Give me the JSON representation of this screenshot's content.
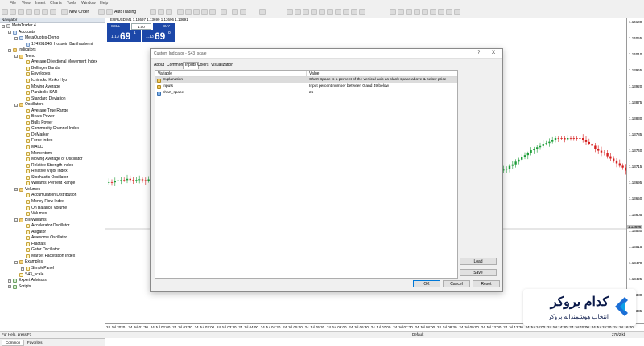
{
  "menu": [
    "File",
    "View",
    "Insert",
    "Charts",
    "Tools",
    "Window",
    "Help"
  ],
  "toolbar": {
    "new_order": "New Order",
    "autotrading": "AutoTrading"
  },
  "chart": {
    "symbol_bar": "EURUSD,M1  1.13697  1.13699  1.13696  1.13691",
    "sell_label": "SELL",
    "buy_label": "BUY",
    "lot": "1.00",
    "sell_price_small": "1.13",
    "sell_price_big": "69",
    "sell_price_sup": "1",
    "buy_price_small": "1.13",
    "buy_price_big": "69",
    "buy_price_sup": "8",
    "price_labels": [
      "1.14100",
      "1.14055",
      "1.14010",
      "1.13965",
      "1.13920",
      "1.13875",
      "1.13830",
      "1.13785",
      "1.13740",
      "1.13715",
      "1.13695",
      "1.13650",
      "1.13605",
      "1.13560",
      "1.13515",
      "1.13470",
      "1.13425",
      "1.13380",
      "1.13335"
    ],
    "current_price": "1.13696",
    "time_labels": [
      "24 Jul 2020",
      "24 Jul 01:30",
      "24 Jul 02:00",
      "24 Jul 02:30",
      "24 Jul 03:00",
      "24 Jul 03:30",
      "24 Jul 04:00",
      "24 Jul 04:30",
      "24 Jul 05:00",
      "24 Jul 05:30",
      "24 Jul 06:00",
      "24 Jul 06:30",
      "24 Jul 07:00",
      "24 Jul 07:30",
      "24 Jul 08:00",
      "24 Jul 08:30",
      "24 Jul 09:00",
      "24 Jul 13:00",
      "24 Jul 13:30",
      "24 Jul 14:00",
      "24 Jul 14:30",
      "24 Jul 15:00",
      "24 Jul 15:30",
      "24 Jul 16:00"
    ]
  },
  "navigator": {
    "title": "Navigator",
    "items": [
      {
        "label": "MetaTrader 4",
        "level": 0,
        "icon": "root",
        "exp": "-"
      },
      {
        "label": "Accounts",
        "level": 1,
        "icon": "acc",
        "exp": "-"
      },
      {
        "label": "MetaQuotes-Demo",
        "level": 2,
        "icon": "acc",
        "exp": "-"
      },
      {
        "label": "174991046: Hossein Banihashemi",
        "level": 3,
        "icon": "acc",
        "exp": ""
      },
      {
        "label": "Indicators",
        "level": 1,
        "icon": "fold",
        "exp": "-"
      },
      {
        "label": "Trend",
        "level": 2,
        "icon": "fold",
        "exp": "-"
      },
      {
        "label": "Average Directional Movement Index",
        "level": 3,
        "icon": "ind",
        "exp": ""
      },
      {
        "label": "Bollinger Bands",
        "level": 3,
        "icon": "ind",
        "exp": ""
      },
      {
        "label": "Envelopes",
        "level": 3,
        "icon": "ind",
        "exp": ""
      },
      {
        "label": "Ichimoku Kinko Hyo",
        "level": 3,
        "icon": "ind",
        "exp": ""
      },
      {
        "label": "Moving Average",
        "level": 3,
        "icon": "ind",
        "exp": ""
      },
      {
        "label": "Parabolic SAR",
        "level": 3,
        "icon": "ind",
        "exp": ""
      },
      {
        "label": "Standard Deviation",
        "level": 3,
        "icon": "ind",
        "exp": ""
      },
      {
        "label": "Oscillators",
        "level": 2,
        "icon": "fold",
        "exp": "-"
      },
      {
        "label": "Average True Range",
        "level": 3,
        "icon": "ind",
        "exp": ""
      },
      {
        "label": "Bears Power",
        "level": 3,
        "icon": "ind",
        "exp": ""
      },
      {
        "label": "Bulls Power",
        "level": 3,
        "icon": "ind",
        "exp": ""
      },
      {
        "label": "Commodity Channel Index",
        "level": 3,
        "icon": "ind",
        "exp": ""
      },
      {
        "label": "DeMarker",
        "level": 3,
        "icon": "ind",
        "exp": ""
      },
      {
        "label": "Force Index",
        "level": 3,
        "icon": "ind",
        "exp": ""
      },
      {
        "label": "MACD",
        "level": 3,
        "icon": "ind",
        "exp": ""
      },
      {
        "label": "Momentum",
        "level": 3,
        "icon": "ind",
        "exp": ""
      },
      {
        "label": "Moving Average of Oscillator",
        "level": 3,
        "icon": "ind",
        "exp": ""
      },
      {
        "label": "Relative Strength Index",
        "level": 3,
        "icon": "ind",
        "exp": ""
      },
      {
        "label": "Relative Vigor Index",
        "level": 3,
        "icon": "ind",
        "exp": ""
      },
      {
        "label": "Stochastic Oscillator",
        "level": 3,
        "icon": "ind",
        "exp": ""
      },
      {
        "label": "Williams' Percent Range",
        "level": 3,
        "icon": "ind",
        "exp": ""
      },
      {
        "label": "Volumes",
        "level": 2,
        "icon": "fold",
        "exp": "-"
      },
      {
        "label": "Accumulation/Distribution",
        "level": 3,
        "icon": "ind",
        "exp": ""
      },
      {
        "label": "Money Flow Index",
        "level": 3,
        "icon": "ind",
        "exp": ""
      },
      {
        "label": "On Balance Volume",
        "level": 3,
        "icon": "ind",
        "exp": ""
      },
      {
        "label": "Volumes",
        "level": 3,
        "icon": "ind",
        "exp": ""
      },
      {
        "label": "Bill Williams",
        "level": 2,
        "icon": "fold",
        "exp": "-"
      },
      {
        "label": "Accelerator Oscillator",
        "level": 3,
        "icon": "ind",
        "exp": ""
      },
      {
        "label": "Alligator",
        "level": 3,
        "icon": "ind",
        "exp": ""
      },
      {
        "label": "Awesome Oscillator",
        "level": 3,
        "icon": "ind",
        "exp": ""
      },
      {
        "label": "Fractals",
        "level": 3,
        "icon": "ind",
        "exp": ""
      },
      {
        "label": "Gator Oscillator",
        "level": 3,
        "icon": "ind",
        "exp": ""
      },
      {
        "label": "Market Facilitation Index",
        "level": 3,
        "icon": "ind",
        "exp": ""
      },
      {
        "label": "Examples",
        "level": 2,
        "icon": "fold",
        "exp": "-"
      },
      {
        "label": "SimplePanel",
        "level": 3,
        "icon": "ind",
        "exp": "+"
      },
      {
        "label": "S43_scale",
        "level": 2,
        "icon": "ind",
        "exp": ""
      },
      {
        "label": "Expert Advisors",
        "level": 1,
        "icon": "ea",
        "exp": "+"
      },
      {
        "label": "Scripts",
        "level": 1,
        "icon": "ea",
        "exp": "+"
      }
    ],
    "tabs": [
      "Common",
      "Favorites"
    ]
  },
  "dialog": {
    "title": "Custom Indicator - S43_scale",
    "help": "?",
    "close": "X",
    "tabs": [
      "About",
      "Common",
      "Inputs",
      "Colors",
      "Visualization"
    ],
    "active_tab": 2,
    "col_variable": "Variable",
    "col_value": "Value",
    "rows": [
      {
        "variable": "Explanation",
        "value": "Chart Space is a percent of the vertical axis as blank space above & below price",
        "icon": "ab",
        "highlight": true
      },
      {
        "variable": "Inputs",
        "value": "Input percent number between 0 and 49 below",
        "icon": "ab",
        "highlight": false
      },
      {
        "variable": "chart_space",
        "value": "25",
        "icon": "num",
        "highlight": false
      }
    ],
    "load": "Load",
    "save": "Save",
    "ok": "OK",
    "cancel": "Cancel",
    "reset": "Reset"
  },
  "status": {
    "help": "For Help, press F1",
    "profile": "Default",
    "traffic": "278/2 kb"
  },
  "watermark": {
    "brand": "کدام بروکر",
    "tagline": "انتخاب هوشمندانه بروکر"
  },
  "colors": {
    "up": "#1f9e3a",
    "down": "#d61f1f",
    "dialog_accent": "#1c47a8"
  }
}
